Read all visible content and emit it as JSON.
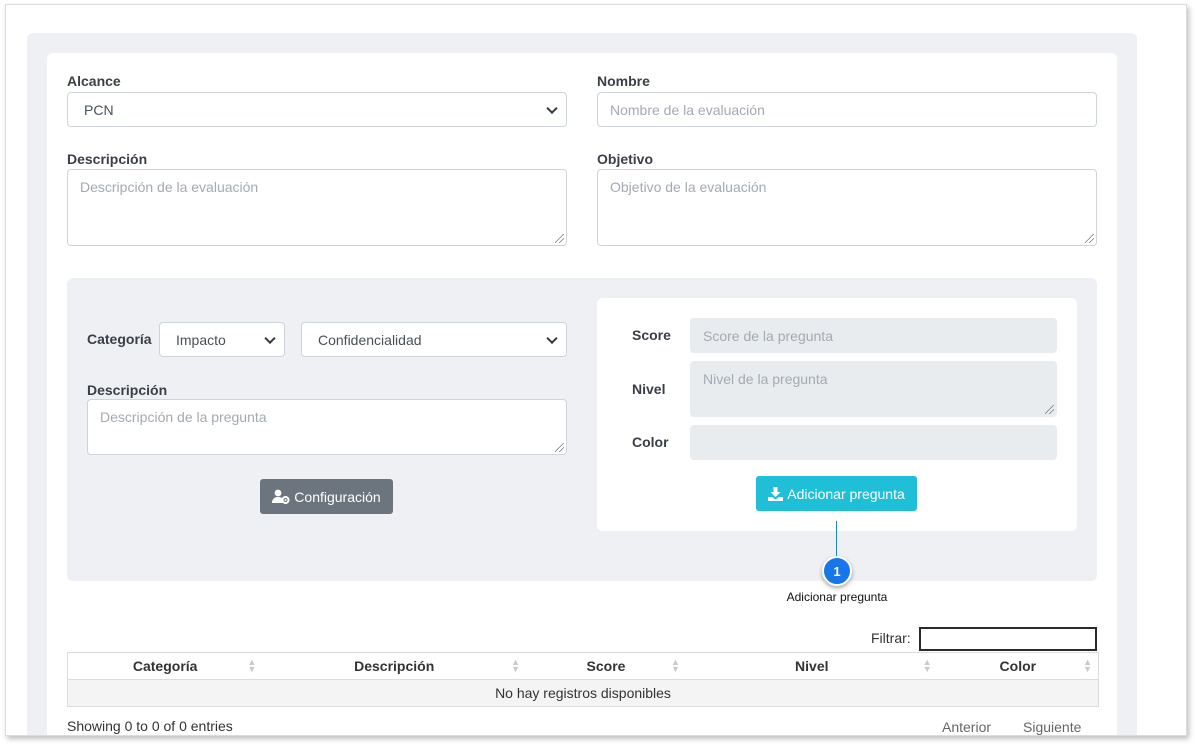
{
  "form": {
    "alcance": {
      "label": "Alcance",
      "value": "PCN"
    },
    "nombre": {
      "label": "Nombre",
      "placeholder": "Nombre de la evaluación"
    },
    "descripcion": {
      "label": "Descripción",
      "placeholder": "Descripción de la evaluación"
    },
    "objetivo": {
      "label": "Objetivo",
      "placeholder": "Objetivo de la evaluación"
    }
  },
  "question": {
    "categoria_label": "Categoría",
    "categoria_value": "Impacto",
    "subcategoria_value": "Confidencialidad",
    "descripcion_label": "Descripción",
    "descripcion_placeholder": "Descripción de la pregunta",
    "config_button": "Configuración",
    "score_label": "Score",
    "score_placeholder": "Score de la pregunta",
    "nivel_label": "Nivel",
    "nivel_placeholder": "Nivel de la pregunta",
    "color_label": "Color",
    "add_button": "Adicionar pregunta"
  },
  "callout": {
    "number": "1",
    "text": "Adicionar pregunta"
  },
  "table": {
    "filter_label": "Filtrar:",
    "columns": [
      "Categoría",
      "Descripción",
      "Score",
      "Nivel",
      "Color"
    ],
    "empty_message": "No hay registros disponibles",
    "info": "Showing 0 to 0 of 0 entries",
    "prev": "Anterior",
    "next": "Siguiente"
  },
  "colors": {
    "accent": "#1fbfd8",
    "secondary": "#6c757d",
    "callout": "#1877e8"
  }
}
